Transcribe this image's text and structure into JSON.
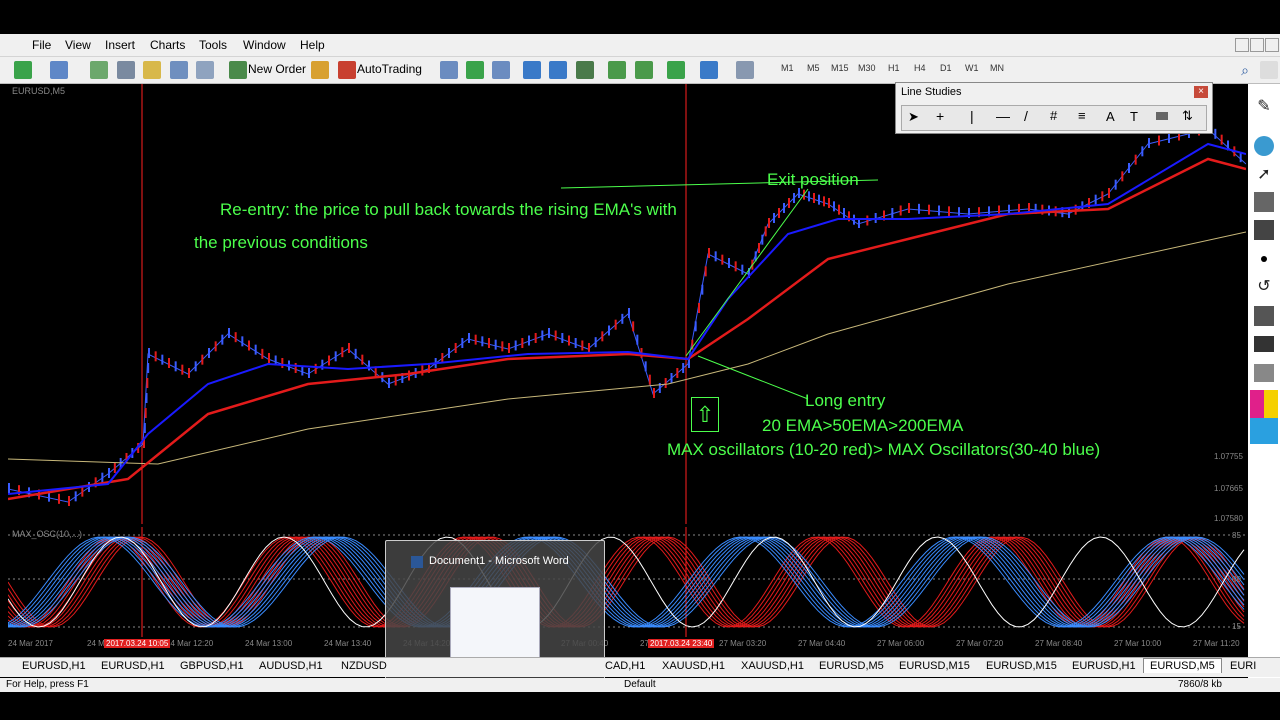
{
  "menu": [
    "File",
    "View",
    "Insert",
    "Charts",
    "Tools",
    "Window",
    "Help"
  ],
  "toolbar": {
    "new_order": "New Order",
    "autotrading": "AutoTrading",
    "timeframes": [
      "M1",
      "M5",
      "M15",
      "M30",
      "H1",
      "H4",
      "D1",
      "W1",
      "MN"
    ]
  },
  "chart": {
    "symbol_label": "EURUSD,M5",
    "price_ticks": [
      "1.07755",
      "1.07665",
      "1.07580"
    ],
    "time_labels": [
      "24 Mar 2017",
      "24 Mar 11:40",
      "24 Mar 12:20",
      "24 Mar 13:00",
      "24 Mar 13:40",
      "24 Mar 14:20",
      "24 Mar 2",
      "27 Mar 00:40",
      "27 Mar 02:00",
      "27 Mar 03:20",
      "27 Mar 04:40",
      "27 Mar 06:00",
      "27 Mar 07:20",
      "27 Mar 08:40",
      "27 Mar 10:00",
      "27 Mar 11:20"
    ],
    "marker_left": "2017.03.24 10:05",
    "marker_right": "2017.03.24 23:40",
    "osc_label": "MAX_OSC(10,...)",
    "osc_ticks": [
      "85",
      "00",
      "15"
    ]
  },
  "annotations": {
    "reentry_1": "Re-entry: the price to pull back towards the rising EMA's with",
    "reentry_2": "the previous conditions",
    "exit": "Exit position",
    "long_1": "Long entry",
    "long_2": "20 EMA>50EMA>200EMA",
    "long_3": "MAX oscillators (10-20 red)> MAX Oscillators(30-40 blue)",
    "arrow": "⇧"
  },
  "line_studies": {
    "title": "Line Studies",
    "close": "×"
  },
  "word_popup": {
    "title": "Document1 - Microsoft Word"
  },
  "tabs": [
    "EURUSD,H1",
    "EURUSD,H1",
    "GBPUSD,H1",
    "AUDUSD,H1",
    "NZDUSD",
    "CAD,H1",
    "XAUUSD,H1",
    "XAUUSD,H1",
    "EURUSD,M5",
    "EURUSD,M15",
    "EURUSD,M15",
    "EURUSD,H1",
    "EURUSD,M5",
    "EURI"
  ],
  "status": {
    "help": "For Help, press F1",
    "profile": "Default",
    "memory": "7860/8 kb"
  },
  "colors": {
    "ema20": "#1a1aff",
    "ema50": "#e31b1b",
    "ema200": "#c8b87a",
    "annotation": "#4cff4c",
    "marker": "#ff2020",
    "osc_red": "#e31b1b",
    "osc_blue": "#3a8cff"
  }
}
